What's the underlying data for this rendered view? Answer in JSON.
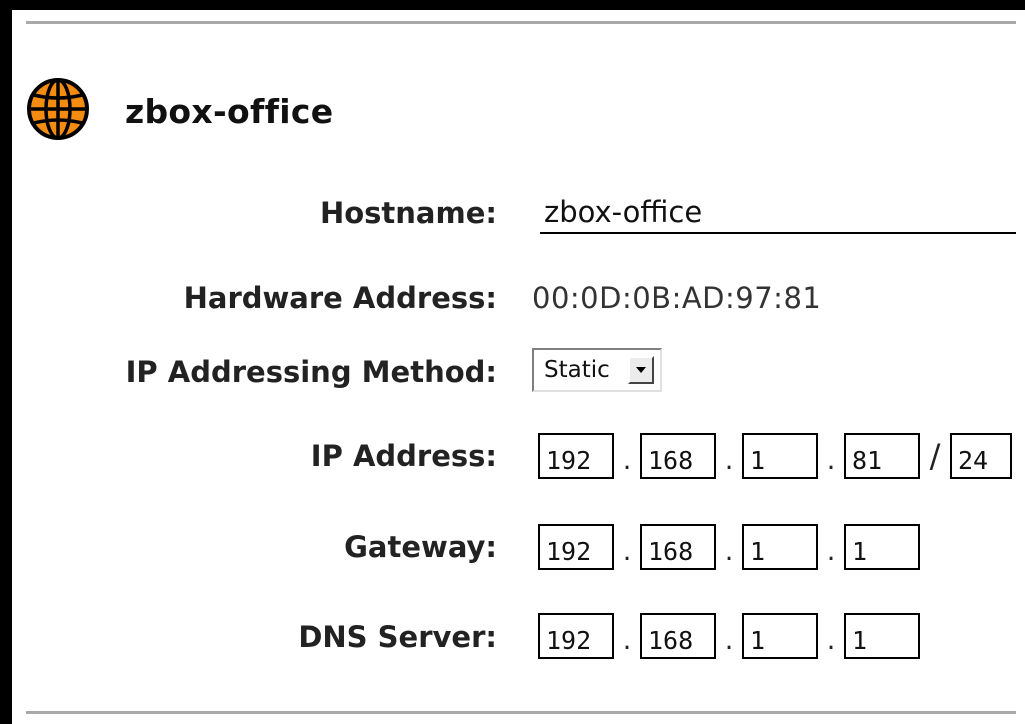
{
  "header": {
    "icon": "globe-icon",
    "icon_color": "#f38c10",
    "title": "zbox-office"
  },
  "form": {
    "hostname": {
      "label": "Hostname:",
      "value": "zbox-office"
    },
    "hardware_address": {
      "label": "Hardware Address:",
      "value": "00:0D:0B:AD:97:81"
    },
    "ip_method": {
      "label": "IP Addressing Method:",
      "selected": "Static"
    },
    "ip_address": {
      "label": "IP Address:",
      "octets": [
        "192",
        "168",
        "1",
        "81"
      ],
      "prefix": "24",
      "separator": ".",
      "slash": "/"
    },
    "gateway": {
      "label": "Gateway:",
      "octets": [
        "192",
        "168",
        "1",
        "1"
      ],
      "separator": "."
    },
    "dns_server": {
      "label": "DNS Server:",
      "octets": [
        "192",
        "168",
        "1",
        "1"
      ],
      "separator": "."
    }
  }
}
